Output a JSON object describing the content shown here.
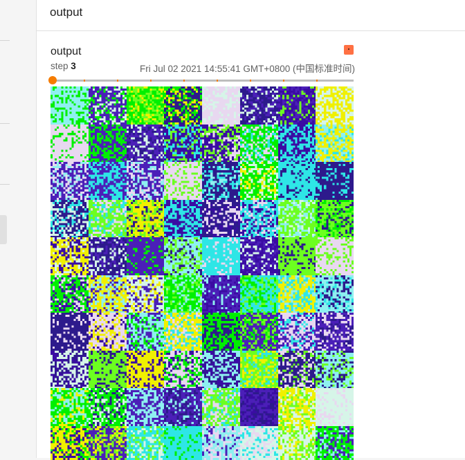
{
  "header": {
    "title": "output"
  },
  "card": {
    "title": "output",
    "step_label": "step",
    "step_value": "3",
    "timestamp": "Fri Jul 02 2021 14:55:41 GMT+0800 (中国标准时间)"
  },
  "slider": {
    "value": 3,
    "max": 3
  },
  "colors": {
    "accent": "#f57c00",
    "corner_badge": "#ff7043",
    "image_palette": [
      "#3a0ca3",
      "#4b1fb8",
      "#2d1a8c",
      "#00f000",
      "#6cff20",
      "#2ee6e6",
      "#8ef0f0",
      "#d6f5e8",
      "#f0f000",
      "#e8d8f0"
    ]
  }
}
